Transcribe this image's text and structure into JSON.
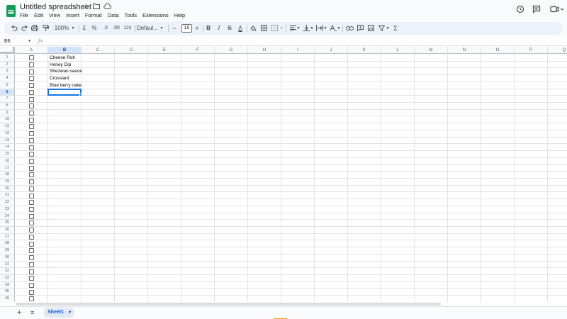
{
  "app": {
    "title": "Untitled spreadsheet",
    "title_icons": [
      "star-icon",
      "move-folder-icon",
      "cloud-status-icon"
    ]
  },
  "menu": [
    "File",
    "Edit",
    "View",
    "Insert",
    "Format",
    "Data",
    "Tools",
    "Extensions",
    "Help"
  ],
  "top_right_icons": [
    "history-icon",
    "comments-icon",
    "meet-icon"
  ],
  "toolbar": {
    "zoom": "100%",
    "currency": "£",
    "percent": "%",
    "decrease_decimal": ".0",
    "increase_decimal": ".00",
    "more_formats": "123",
    "font": "Defaul...",
    "font_size": "10",
    "minus": "−",
    "plus": "+",
    "bold": "B",
    "italic": "I",
    "strike": "S",
    "text_color": "A",
    "sum": "Σ"
  },
  "formula_bar": {
    "name_box": "B6",
    "fx": "fx",
    "content": ""
  },
  "columns": [
    "A",
    "B",
    "C",
    "D",
    "E",
    "F",
    "G",
    "H",
    "I",
    "J",
    "K",
    "L",
    "M",
    "N",
    "O",
    "P",
    "Q"
  ],
  "selected_column": "B",
  "rows": [
    "1",
    "2",
    "3",
    "4",
    "5",
    "6",
    "7",
    "8",
    "9",
    "10",
    "11",
    "12",
    "13",
    "14",
    "15",
    "16",
    "17",
    "18",
    "19",
    "20",
    "21",
    "22",
    "23",
    "24",
    "25",
    "26",
    "27",
    "28",
    "29",
    "30",
    "31",
    "32",
    "33",
    "34",
    "35",
    "36"
  ],
  "selected_row": "6",
  "cells": {
    "B1": "Cheese Roll",
    "B2": "Honey Dip",
    "B3": "Shezwan sauce",
    "B4": "Crossiant",
    "B5": "Blue berry cake"
  },
  "checkbox_column": "A",
  "sheet_tabs": [
    {
      "label": "Sheet1",
      "active": true
    }
  ],
  "colors": {
    "accent": "#1a73e8",
    "selected_header_bg": "#d3e3fd",
    "toolbar_bg": "#edf2fa",
    "sheets_green": "#0f9d58"
  }
}
